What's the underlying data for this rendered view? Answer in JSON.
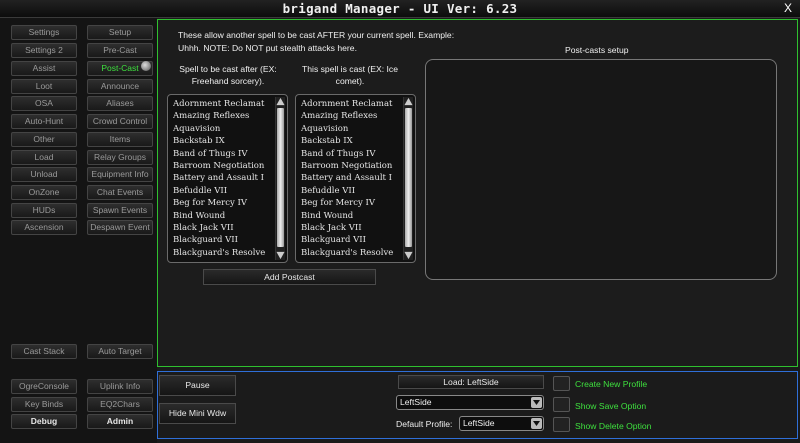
{
  "window": {
    "title": "brigand Manager   - UI Ver: 6.23",
    "close_label": "X"
  },
  "nav": {
    "left_column": [
      "Settings",
      "Settings 2",
      "Assist",
      "Loot",
      "OSA",
      "Auto-Hunt",
      "Other",
      "Load",
      "Unload",
      "OnZone",
      "HUDs",
      "Ascension"
    ],
    "right_column": [
      "Setup",
      "Pre-Cast",
      "Post-Cast",
      "Announce",
      "Aliases",
      "Crowd Control",
      "Items",
      "Relay Groups",
      "Equipment Info",
      "Chat Events",
      "Spawn Events",
      "Despawn Event"
    ],
    "active": "Post-Cast",
    "cast_stack": "Cast Stack",
    "auto_target": "Auto Target",
    "ogre_console": "OgreConsole",
    "uplink_info": "Uplink Info",
    "key_binds": "Key Binds",
    "eq2chars": "EQ2Chars",
    "debug": "Debug",
    "admin": "Admin"
  },
  "main": {
    "description": "These allow another spell to be cast AFTER your current spell. Example: Uhhh. NOTE: Do NOT put stealth attacks here.",
    "col1_header": "Spell to be cast after (EX: Freehand sorcery).",
    "col2_header": "This spell is cast (EX: Ice comet).",
    "postcast_header": "Post-casts setup",
    "spells": [
      "Adornment Reclamat",
      "Amazing Reflexes",
      "Aquavision",
      "Backstab IX",
      "Band of Thugs IV",
      "Barroom Negotiation",
      "Battery and Assault I",
      "Befuddle VII",
      "Beg for Mercy IV",
      "Bind Wound",
      "Black Jack VII",
      "Blackguard VII",
      "Blackguard's Resolve"
    ],
    "add_button": "Add Postcast"
  },
  "bottom": {
    "pause": "Pause",
    "hide_mini": "Hide Mini Wdw",
    "load": "Load: LeftSide",
    "profile_value": "LeftSide",
    "default_profile_label": "Default Profile:",
    "default_profile_value": "LeftSide",
    "create_profile": "Create New Profile",
    "show_save": "Show Save Option",
    "show_delete": "Show Delete Option"
  },
  "colors": {
    "active_nav": "#3ee03e",
    "main_border": "#2fc02f",
    "bottom_border": "#2f6fd8",
    "option_label": "#3ee03e"
  }
}
